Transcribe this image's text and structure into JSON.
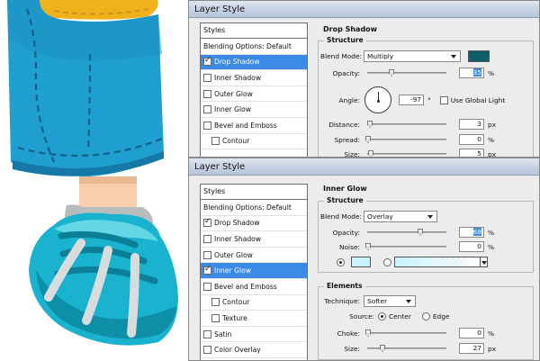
{
  "dialog_top": {
    "title": "Layer Style",
    "styles_header": "Styles",
    "style_items": [
      {
        "label": "Blending Options: Default",
        "checkbox": false,
        "checked": false,
        "selected": false,
        "sub": false
      },
      {
        "label": "Drop Shadow",
        "checkbox": true,
        "checked": true,
        "selected": true,
        "sub": false
      },
      {
        "label": "Inner Shadow",
        "checkbox": true,
        "checked": false,
        "selected": false,
        "sub": false
      },
      {
        "label": "Outer Glow",
        "checkbox": true,
        "checked": false,
        "selected": false,
        "sub": false
      },
      {
        "label": "Inner Glow",
        "checkbox": true,
        "checked": false,
        "selected": false,
        "sub": false
      },
      {
        "label": "Bevel and Emboss",
        "checkbox": true,
        "checked": false,
        "selected": false,
        "sub": false
      },
      {
        "label": "Contour",
        "checkbox": true,
        "checked": false,
        "selected": false,
        "sub": true
      }
    ],
    "section_title": "Drop Shadow",
    "group_title": "Structure",
    "blend_mode_label": "Blend Mode:",
    "blend_mode_value": "Multiply",
    "shadow_color": "#0f5e6b",
    "opacity_label": "Opacity:",
    "opacity_value": "35",
    "opacity_unit": "%",
    "angle_label": "Angle:",
    "angle_value": "-97",
    "angle_unit": "°",
    "global_light_label": "Use Global Light",
    "distance_label": "Distance:",
    "distance_value": "3",
    "distance_unit": "px",
    "spread_label": "Spread:",
    "spread_value": "0",
    "spread_unit": "%",
    "size_label": "Size:",
    "size_value": "5",
    "size_unit": "px"
  },
  "dialog_bottom": {
    "title": "Layer Style",
    "styles_header": "Styles",
    "style_items": [
      {
        "label": "Blending Options: Default",
        "checkbox": false,
        "checked": false,
        "selected": false,
        "sub": false
      },
      {
        "label": "Drop Shadow",
        "checkbox": true,
        "checked": true,
        "selected": false,
        "sub": false
      },
      {
        "label": "Inner Shadow",
        "checkbox": true,
        "checked": false,
        "selected": false,
        "sub": false
      },
      {
        "label": "Outer Glow",
        "checkbox": true,
        "checked": false,
        "selected": false,
        "sub": false
      },
      {
        "label": "Inner Glow",
        "checkbox": true,
        "checked": true,
        "selected": true,
        "sub": false
      },
      {
        "label": "Bevel and Emboss",
        "checkbox": true,
        "checked": false,
        "selected": false,
        "sub": false
      },
      {
        "label": "Contour",
        "checkbox": true,
        "checked": false,
        "selected": false,
        "sub": true
      },
      {
        "label": "Texture",
        "checkbox": true,
        "checked": false,
        "selected": false,
        "sub": true
      },
      {
        "label": "Satin",
        "checkbox": true,
        "checked": false,
        "selected": false,
        "sub": false
      },
      {
        "label": "Color Overlay",
        "checkbox": true,
        "checked": false,
        "selected": false,
        "sub": false
      }
    ],
    "section_title": "Inner Glow",
    "structure_title": "Structure",
    "blend_mode_label": "Blend Mode:",
    "blend_mode_value": "Overlay",
    "opacity_label": "Opacity:",
    "opacity_value": "68",
    "opacity_unit": "%",
    "noise_label": "Noise:",
    "noise_value": "0",
    "noise_unit": "%",
    "glow_color": "#c8f3ff",
    "elements_title": "Elements",
    "technique_label": "Technique:",
    "technique_value": "Softer",
    "source_label": "Source:",
    "source_center": "Center",
    "source_edge": "Edge",
    "choke_label": "Choke:",
    "choke_value": "0",
    "choke_unit": "%",
    "size_label": "Size:",
    "size_value": "27",
    "size_unit": "px"
  }
}
